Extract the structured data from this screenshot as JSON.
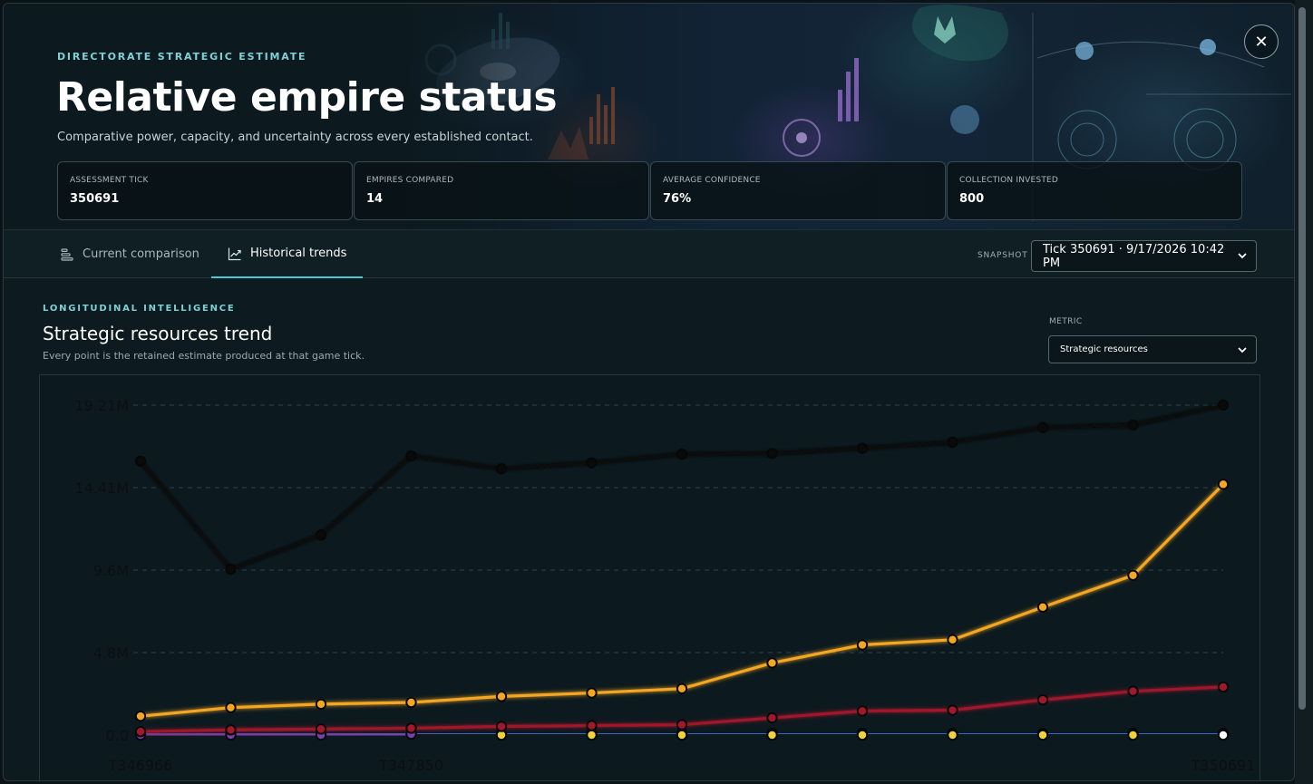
{
  "header": {
    "eyebrow": "DIRECTORATE STRATEGIC ESTIMATE",
    "title": "Relative empire status",
    "subtitle": "Comparative power, capacity, and uncertainty across every established contact.",
    "close_icon": "close-icon"
  },
  "stats": [
    {
      "label": "ASSESSMENT TICK",
      "value": "350691"
    },
    {
      "label": "EMPIRES COMPARED",
      "value": "14"
    },
    {
      "label": "AVERAGE CONFIDENCE",
      "value": "76%"
    },
    {
      "label": "COLLECTION INVESTED",
      "value": "800"
    }
  ],
  "tabs": [
    {
      "label": "Current comparison",
      "icon": "bars-icon",
      "active": false
    },
    {
      "label": "Historical trends",
      "icon": "trend-icon",
      "active": true
    }
  ],
  "snapshot": {
    "label": "SNAPSHOT",
    "value": "Tick 350691 · 9/17/2026 10:42 PM"
  },
  "section": {
    "eyebrow": "LONGITUDINAL INTELLIGENCE",
    "title": "Strategic resources trend",
    "subtitle": "Every point is the retained estimate produced at that game tick."
  },
  "metric": {
    "label": "METRIC",
    "value": "Strategic resources"
  },
  "colors": {
    "accent": "#4fc8cf",
    "series_black": "#0a0a0a",
    "series_orange": "#f5a623",
    "series_red": "#a0182c",
    "series_yellow": "#f1d23a",
    "series_purple": "#7a3fb0",
    "series_blue": "#3a66c8",
    "series_white": "#ffffff"
  },
  "chart_data": {
    "type": "line",
    "x": [
      346966,
      347300,
      347600,
      347850,
      348100,
      348400,
      348700,
      349000,
      349300,
      349600,
      349900,
      350200,
      350691
    ],
    "x_tick_labels": [
      "T346966",
      "T347850",
      "T350691"
    ],
    "y_tick_labels": [
      "0.0",
      "4.8M",
      "9.6M",
      "14.41M",
      "19.21M"
    ],
    "ylim": [
      0,
      19.21
    ],
    "grid": true,
    "series": [
      {
        "color": "#0a0a0a",
        "values": [
          15.95,
          9.65,
          11.65,
          16.25,
          15.5,
          15.85,
          16.35,
          16.4,
          16.7,
          17.05,
          17.9,
          18.05,
          19.21
        ]
      },
      {
        "color": "#f5a623",
        "values": [
          1.1,
          1.6,
          1.8,
          1.9,
          2.25,
          2.45,
          2.7,
          4.2,
          5.25,
          5.55,
          7.45,
          9.3,
          14.6
        ]
      },
      {
        "color": "#a0182c",
        "values": [
          0.2,
          0.3,
          0.35,
          0.4,
          0.5,
          0.55,
          0.6,
          1.0,
          1.4,
          1.45,
          2.05,
          2.55,
          2.8
        ]
      },
      {
        "color": "#7a3fb0",
        "values": [
          0.0,
          0.0,
          0.0,
          0.05,
          null,
          null,
          null,
          null,
          null,
          null,
          null,
          null,
          null
        ]
      },
      {
        "color": "#3a66c8",
        "values": [
          0.08,
          0.1,
          0.1,
          0.1,
          0.1,
          0.1,
          0.1,
          0.1,
          0.1,
          0.1,
          0.1,
          0.1,
          0.1
        ]
      },
      {
        "color": "#f1d23a",
        "values": [
          null,
          null,
          null,
          null,
          0.0,
          0.0,
          0.0,
          0.0,
          0.0,
          0.0,
          0.0,
          0.0,
          null
        ]
      },
      {
        "color": "#ffffff",
        "values": [
          null,
          null,
          null,
          null,
          null,
          null,
          null,
          null,
          null,
          null,
          null,
          null,
          0.0
        ]
      }
    ]
  }
}
